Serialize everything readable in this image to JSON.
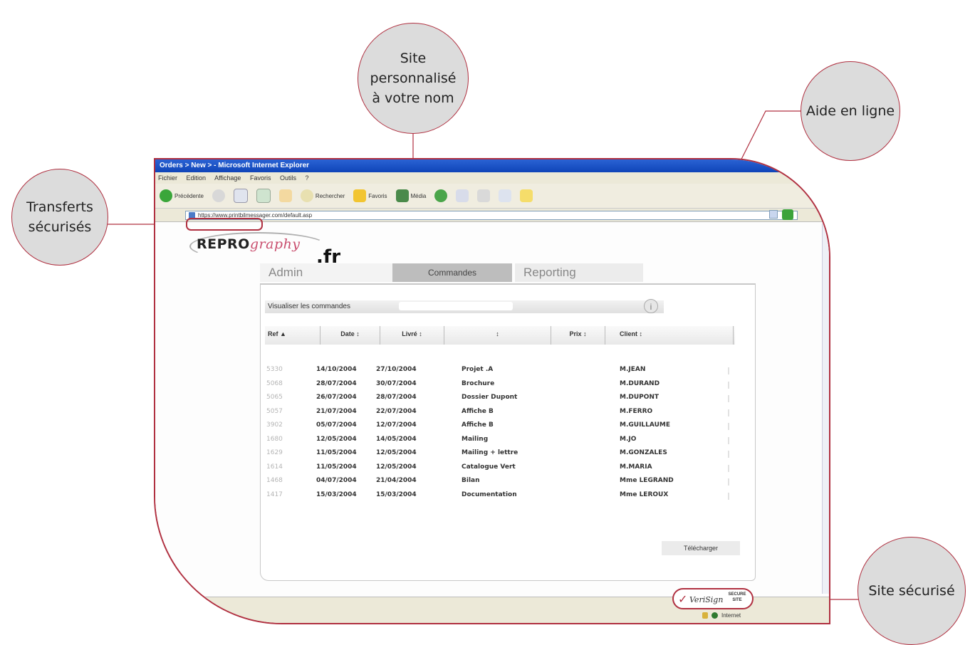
{
  "callouts": {
    "site_name": "Site personnalisé\nà votre nom",
    "help": "Aide en ligne",
    "transfers": "Transferts\nsécurisés",
    "secure": "Site sécurisé"
  },
  "browser": {
    "title": "Orders > New > - Microsoft Internet Explorer",
    "menu": [
      "Fichier",
      "Edition",
      "Affichage",
      "Favoris",
      "Outils",
      "?"
    ],
    "toolbar": {
      "back": "Précédente",
      "search": "Rechercher",
      "favorites": "Favoris",
      "media": "Média"
    },
    "address": "https://www.printbilmessager.com/default.asp"
  },
  "logo": {
    "repro": "REPRO",
    "graphy": "graphy",
    "fr": ".fr"
  },
  "tabs": [
    "Admin",
    "Commandes",
    "Reporting"
  ],
  "panel": {
    "heading": "Visualiser les commandes",
    "columns": [
      "Ref",
      "Date",
      "Livré",
      "",
      "Prix",
      "Client"
    ],
    "orders": [
      {
        "ref": "5330",
        "date": "14/10/2004",
        "livre": "27/10/2004",
        "projet": "Projet .A",
        "client": "M.JEAN"
      },
      {
        "ref": "5068",
        "date": "28/07/2004",
        "livre": "30/07/2004",
        "projet": "Brochure",
        "client": "M.DURAND"
      },
      {
        "ref": "5065",
        "date": "26/07/2004",
        "livre": "28/07/2004",
        "projet": "Dossier Dupont",
        "client": "M.DUPONT"
      },
      {
        "ref": "5057",
        "date": "21/07/2004",
        "livre": "22/07/2004",
        "projet": "Affiche B",
        "client": "M.FERRO"
      },
      {
        "ref": "3902",
        "date": "05/07/2004",
        "livre": "12/07/2004",
        "projet": "Affiche B",
        "client": "M.GUILLAUME"
      },
      {
        "ref": "1680",
        "date": "12/05/2004",
        "livre": "14/05/2004",
        "projet": "Mailing",
        "client": "M.JO"
      },
      {
        "ref": "1629",
        "date": "11/05/2004",
        "livre": "12/05/2004",
        "projet": "Mailing + lettre",
        "client": "M.GONZALES"
      },
      {
        "ref": "1614",
        "date": "11/05/2004",
        "livre": "12/05/2004",
        "projet": "Catalogue Vert",
        "client": "M.MARIA"
      },
      {
        "ref": "1468",
        "date": "04/07/2004",
        "livre": "21/04/2004",
        "projet": "Bilan",
        "client": "Mme LEGRAND"
      },
      {
        "ref": "1417",
        "date": "15/03/2004",
        "livre": "15/03/2004",
        "projet": "Documentation",
        "client": "Mme LEROUX"
      }
    ],
    "download": "Télécharger"
  },
  "status": {
    "verisign": "VeriSign",
    "verisign_badge": "SECURE SITE",
    "zone": "Internet"
  },
  "colors": {
    "accent": "#b03040",
    "title_bar": "#1a55c8"
  }
}
